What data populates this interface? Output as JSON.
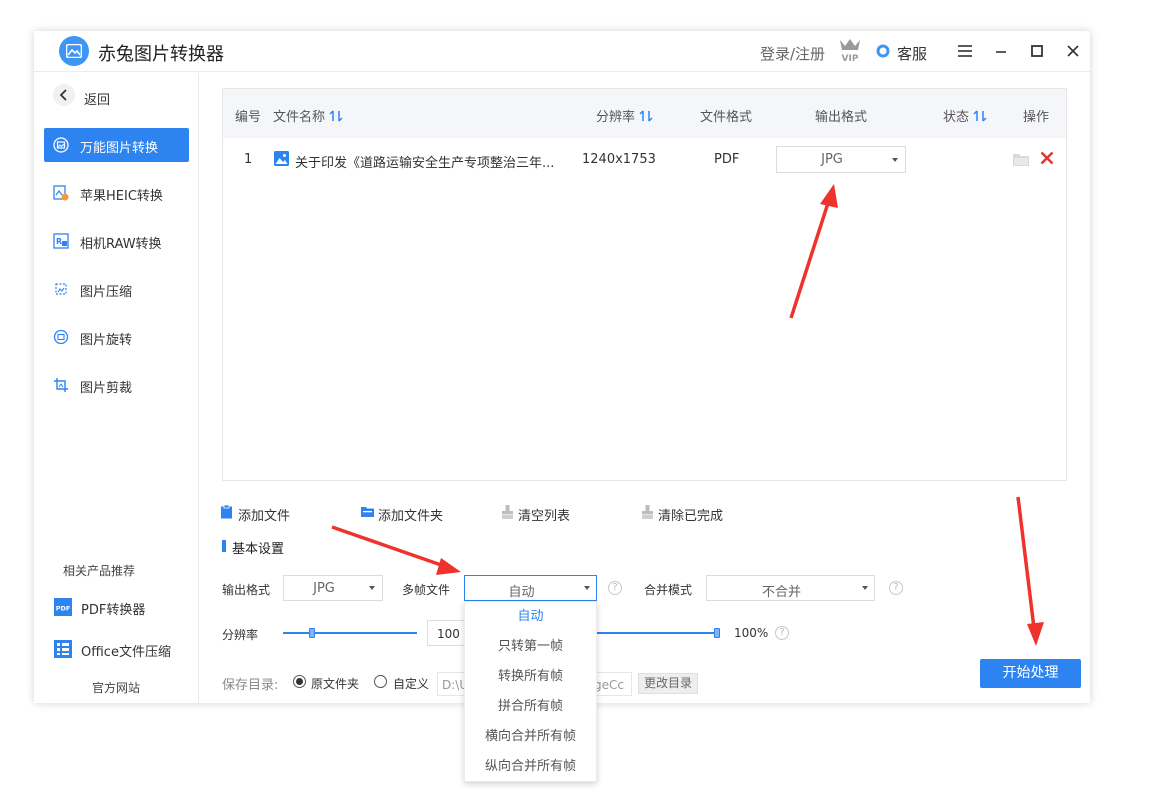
{
  "app": {
    "title": "赤兔图片转换器",
    "login_link": "登录/注册",
    "vip_icon": "vip-crown-icon",
    "service_label": "客服",
    "controls": [
      "menu-icon",
      "minimize-icon",
      "maximize-icon",
      "close-icon"
    ]
  },
  "sidebar": {
    "back_label": "返回",
    "items": [
      {
        "label": "万能图片转换",
        "icon": "image-convert-icon",
        "active": true
      },
      {
        "label": "苹果HEIC转换",
        "icon": "heic-icon",
        "active": false
      },
      {
        "label": "相机RAW转换",
        "icon": "raw-icon",
        "active": false
      },
      {
        "label": "图片压缩",
        "icon": "compress-icon",
        "active": false
      },
      {
        "label": "图片旋转",
        "icon": "rotate-icon",
        "active": false
      },
      {
        "label": "图片剪裁",
        "icon": "crop-icon",
        "active": false
      }
    ],
    "related_title": "相关产品推荐",
    "products": [
      {
        "label": "PDF转换器",
        "icon": "pdf-icon"
      },
      {
        "label": "Office文件压缩",
        "icon": "office-icon"
      }
    ],
    "website_link": "官方网站"
  },
  "table": {
    "headers": {
      "index": "编号",
      "name": "文件名称",
      "resolution": "分辨率",
      "format": "文件格式",
      "output": "输出格式",
      "status": "状态",
      "action": "操作"
    },
    "rows": [
      {
        "index": "1",
        "name": "关于印发《道路运输安全生产专项整治三年...",
        "resolution": "1240x1753",
        "format": "PDF",
        "output": "JPG",
        "status": ""
      }
    ]
  },
  "actions": {
    "add_file": "添加文件",
    "add_folder": "添加文件夹",
    "clear_list": "清空列表",
    "clear_done": "清除已完成"
  },
  "settings": {
    "title": "基本设置",
    "output_format_label": "输出格式",
    "output_format_value": "JPG",
    "multiframe_label": "多帧文件",
    "multiframe_value": "自动",
    "merge_label": "合并模式",
    "merge_value": "不合并",
    "resolution_label": "分辨率",
    "resolution_value": "100",
    "quality_value": "100%",
    "resolution_slider_fraction": 0.22,
    "quality_slider_fraction": 1.0,
    "save_dir_label": "保存目录:",
    "radio_original": "原文件夹",
    "radio_custom": "自定义",
    "save_path": "D:\\U",
    "save_path_tail": "geCc",
    "change_dir": "更改目录",
    "help_glyph": "?"
  },
  "multiframe_options": [
    "自动",
    "只转第一帧",
    "转换所有帧",
    "拼合所有帧",
    "横向合并所有帧",
    "纵向合并所有帧"
  ],
  "start_button": "开始处理",
  "colors": {
    "accent": "#2d84f0",
    "arrow": "#f0322d"
  }
}
